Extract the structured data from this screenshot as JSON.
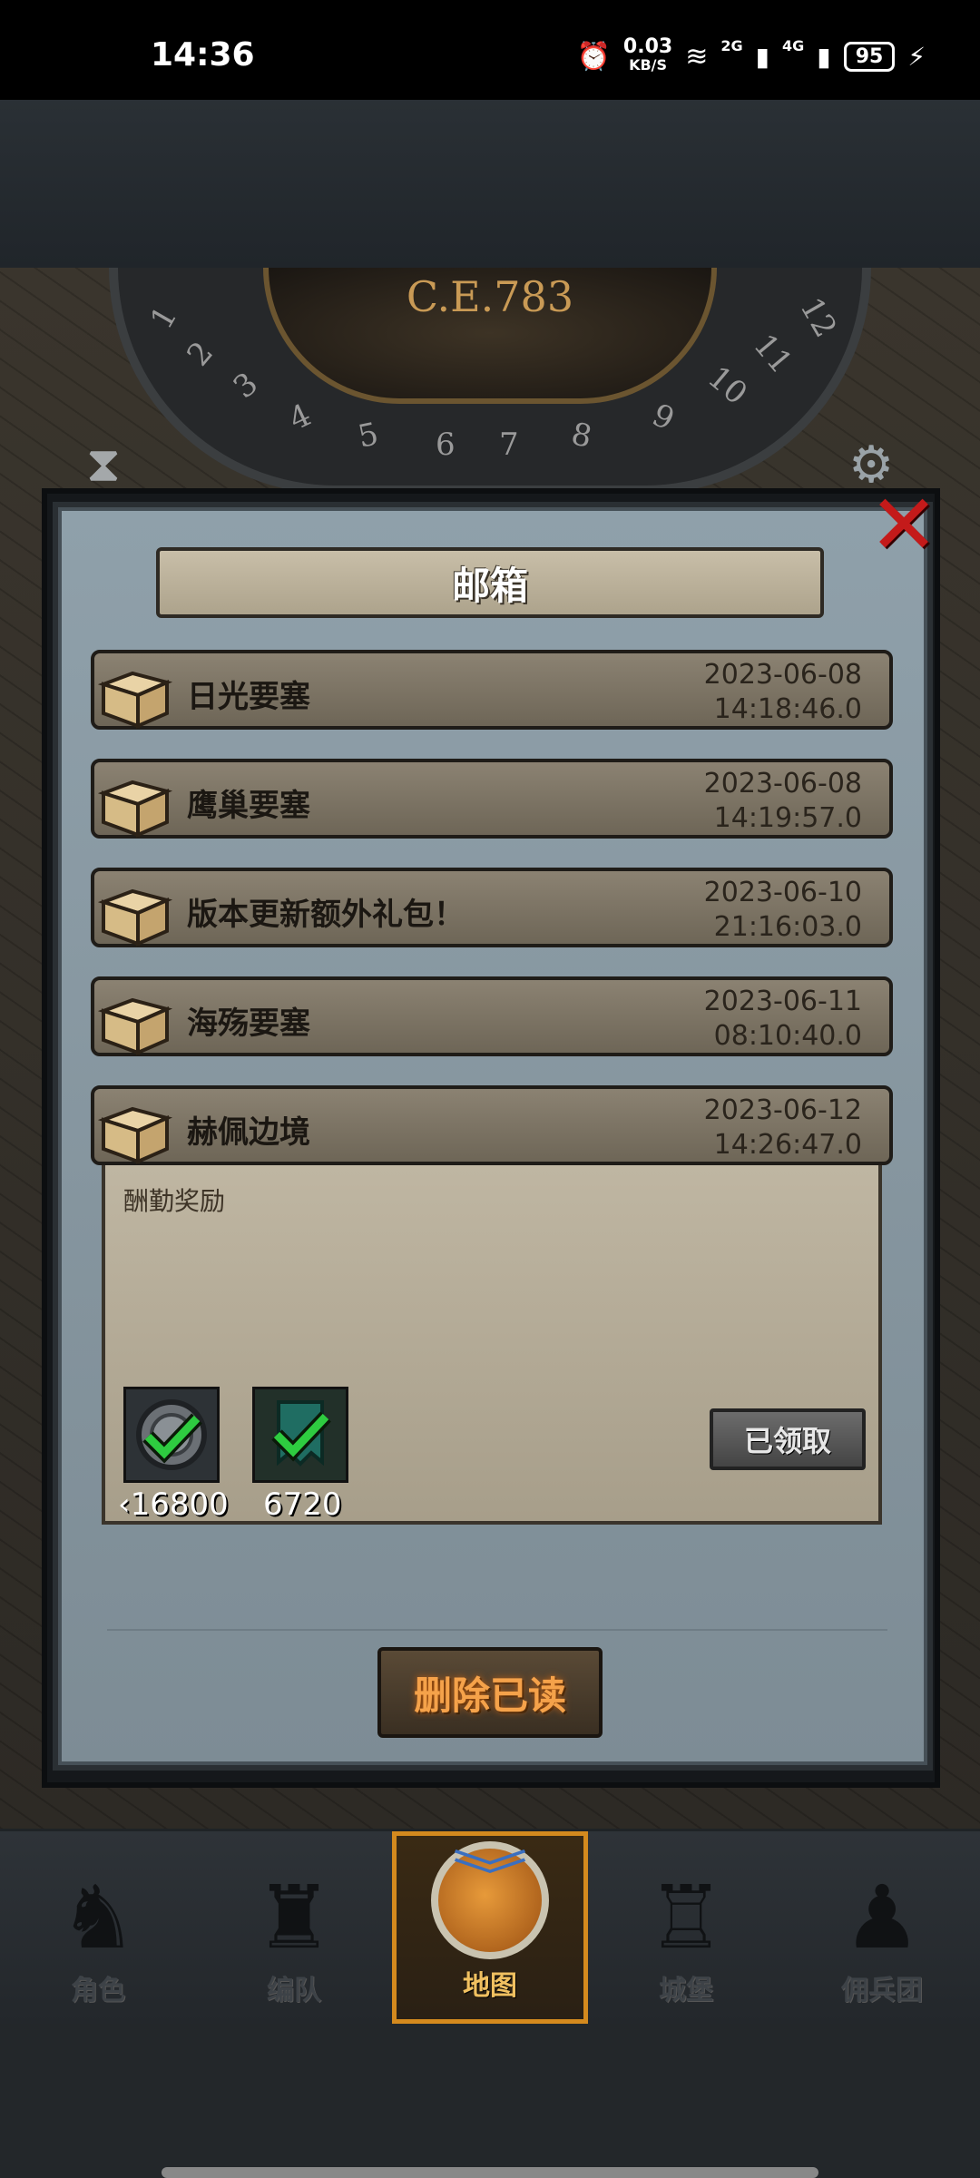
{
  "status_bar": {
    "time": "14:36",
    "speed_value": "0.03",
    "speed_unit": "KB/S",
    "network_2g": "2G",
    "network_4g": "4G",
    "battery": "95"
  },
  "game": {
    "era_label": "C.E.783",
    "dial_numbers": [
      "1",
      "2",
      "3",
      "4",
      "5",
      "6",
      "7",
      "8",
      "9",
      "10",
      "11",
      "12"
    ]
  },
  "mailbox": {
    "title": "邮箱",
    "mails": [
      {
        "subject": "日光要塞",
        "date": "2023-06-08",
        "time": "14:18:46.0"
      },
      {
        "subject": "鹰巢要塞",
        "date": "2023-06-08",
        "time": "14:19:57.0"
      },
      {
        "subject": "版本更新额外礼包！",
        "date": "2023-06-10",
        "time": "21:16:03.0"
      },
      {
        "subject": "海殇要塞",
        "date": "2023-06-11",
        "time": "08:10:40.0"
      },
      {
        "subject": "赫佩边境",
        "date": "2023-06-12",
        "time": "14:26:47.0"
      }
    ],
    "detail": {
      "content": "酬勤奖励",
      "rewards": [
        {
          "amount": "‹16800",
          "icon": "silver-coin-icon"
        },
        {
          "amount": "6720",
          "icon": "banner-icon"
        }
      ],
      "claimed_label": "已领取"
    },
    "delete_read_label": "删除已读"
  },
  "nav": {
    "items": [
      {
        "label": "角色",
        "icon": "knight-icon"
      },
      {
        "label": "编队",
        "icon": "squad-icon"
      },
      {
        "label": "地图",
        "icon": "globe-icon"
      },
      {
        "label": "城堡",
        "icon": "castle-icon"
      },
      {
        "label": "佣兵团",
        "icon": "mercenary-icon"
      }
    ],
    "active_index": 2
  },
  "colors": {
    "accent_orange": "#f5a24a",
    "close_red": "#c41a1a",
    "claimed_gray": "#555555",
    "check_green": "#2ecc40"
  }
}
